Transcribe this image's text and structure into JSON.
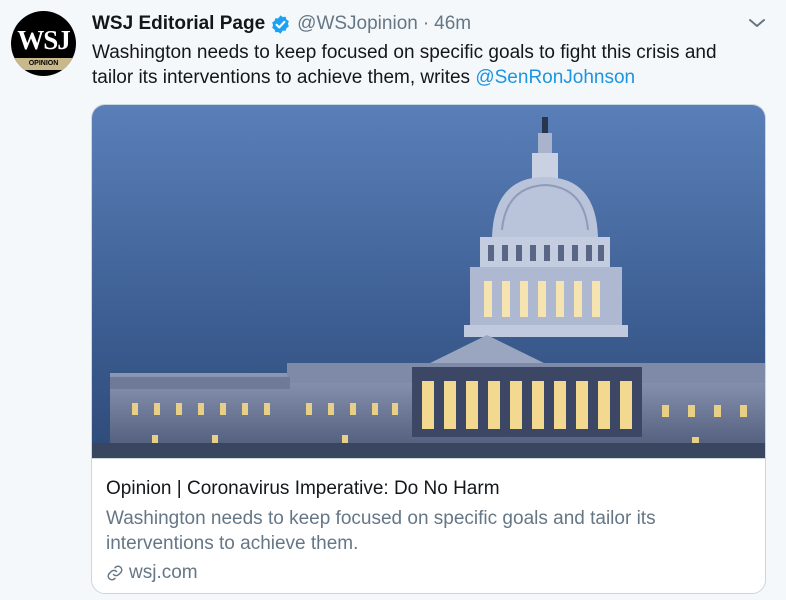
{
  "author": {
    "display_name": "WSJ Editorial Page",
    "handle": "@WSJopinion",
    "separator": "·",
    "time": "46m",
    "avatar": {
      "logo_text": "WSJ",
      "band_text": "OPINION"
    },
    "verified": true
  },
  "tweet": {
    "text_main": "Washington needs to keep focused on specific goals to fight this crisis and tailor its interventions to achieve them, writes ",
    "mention": "@SenRonJohnson"
  },
  "card": {
    "image_alt": "U.S. Capitol building at dusk",
    "title": "Opinion | Coronavirus Imperative: Do No Harm",
    "description": "Washington needs to keep focused on specific goals and tailor its interventions to achieve them.",
    "domain": "wsj.com"
  },
  "colors": {
    "background": "#f5f8fa",
    "primary_text": "#14171a",
    "secondary_text": "#657786",
    "link": "#1b95e0",
    "verified_badge": "#1da1f2",
    "border": "#ccd6dd"
  },
  "icons": {
    "verified": "verified-badge-icon",
    "more": "chevron-down-icon",
    "link": "link-icon"
  }
}
